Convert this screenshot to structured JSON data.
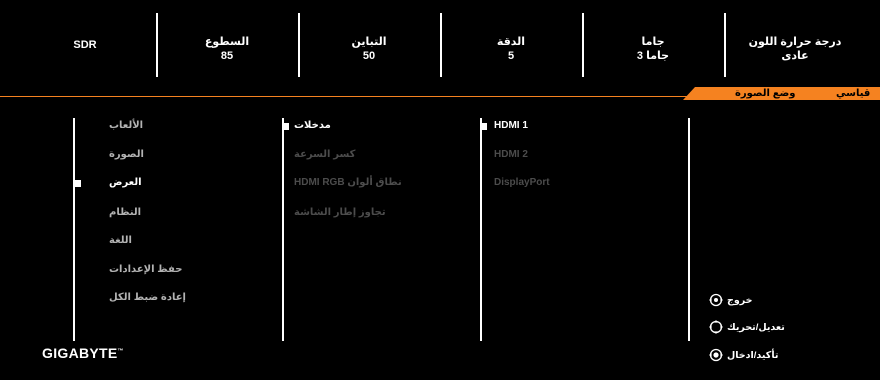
{
  "status": [
    {
      "label": "SDR",
      "value": ""
    },
    {
      "label": "السطوع",
      "value": "85"
    },
    {
      "label": "التباين",
      "value": "50"
    },
    {
      "label": "الدقة",
      "value": "5"
    },
    {
      "label": "جاما",
      "value": "جاما 3"
    },
    {
      "label": "درجة حرارة اللون",
      "value": "عادى"
    }
  ],
  "tabs": {
    "standard": "قياسي",
    "picture_mode": "وضع الصورة"
  },
  "main_menu": [
    "الألعاب",
    "الصورة",
    "العرض",
    "النظام",
    "اللغة",
    "حفظ الإعدادات",
    "إعادة ضبط الكل"
  ],
  "sub_menu": [
    "مدخلات",
    "كسر السرعة",
    "نطاق ألوان HDMI RGB",
    "تجاوز إطار الشاشة"
  ],
  "inputs": [
    "HDMI 1",
    "HDMI 2",
    "DisplayPort"
  ],
  "hints": {
    "exit": "خروج",
    "move": "تعديل/تحريك",
    "confirm": "تأكيد/ادخال"
  },
  "brand": "GIGABYTE",
  "colors": {
    "accent": "#f58220",
    "background": "#000000"
  }
}
